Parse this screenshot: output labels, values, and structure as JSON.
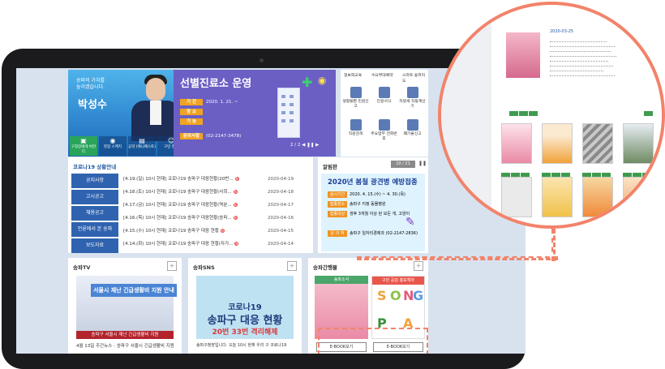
{
  "mayor": {
    "tagline_1": "송파의 가치를",
    "tagline_2": "높이겠습니다.",
    "name": "박성수",
    "tiles": [
      "구청장에게 바란다",
      "현장 스케치",
      "공약 (매니페스토)",
      "구민 청원"
    ]
  },
  "clinic_banner": {
    "title": "선별진료소 운영",
    "rows": [
      {
        "label": "기    간",
        "value": "2020. 1. 21. ~"
      },
      {
        "label": "장    소",
        "value": ""
      },
      {
        "label": "기    능",
        "value": ""
      },
      {
        "label": "문의사항",
        "value": "(02-2147-3478)"
      }
    ],
    "pager": "2 / 2"
  },
  "quick_menu": {
    "headers": [
      "정보화교육",
      "수요부대예약",
      "스마트 송파지도"
    ],
    "items": [
      "생활불편 민원신고",
      "민원서식",
      "지방세 자동계산기",
      "직원검색",
      "주요업무 전화번호",
      "폐기물신고"
    ]
  },
  "covid_board": {
    "title": "코로나19 상황안내",
    "tabs": [
      "공지사항",
      "고시공고",
      "채용공고",
      "언론에서 본 송파",
      "보도자료"
    ],
    "items": [
      {
        "text": "[4.19.(일) 10시 현재] 코로나19 송파구 대응현황(20번...",
        "date": "2020-04-19"
      },
      {
        "text": "[4.18.(토) 10시 현재] 코로나19 송파구 대응현황(사회...",
        "date": "2020-04-18"
      },
      {
        "text": "[4.17.(금) 10시 현재] 코로나19 송파구 대응현황(역분...",
        "date": "2020-04-17"
      },
      {
        "text": "[4.16.(목) 10시 현재] 코로나19 송파구 대응현황(송파...",
        "date": "2020-04-16"
      },
      {
        "text": "[4.15.(수) 10시 현재] 코로나19 송파구 대응 현황",
        "date": "2020-04-15"
      },
      {
        "text": "[4.14.(화) 10시 현재] 코로나19 송파구 대응 현황(자가...",
        "date": "2020-04-14"
      }
    ]
  },
  "notice_board": {
    "title": "알림판",
    "counter": "10 / 21",
    "poster_title": "2020년 봄철 광견병 예방접종",
    "rows": [
      {
        "label": "실시기간",
        "value": "2020. 4. 15.(수) ~ 4. 30.(목)"
      },
      {
        "label": "접종장소",
        "value": "송파구 지정 동물병원"
      },
      {
        "label": "접종대상",
        "value": "생후 3개월 이상 된 모든 개, 고양이"
      },
      {
        "label": "문 의 처",
        "value": "송파구 일자리경제과 (02-2147-2836)"
      }
    ]
  },
  "songpa_tv": {
    "title": "송파TV",
    "thumb_title": "서울시 재난 긴급생활비 지원 안내",
    "thumb_sub": "송파구 서울시 재난 긴급생활비 지원",
    "caption": "4월 13일 주간뉴스 - 송파구 서울시 긴급생활비 지원"
  },
  "songpa_sns": {
    "title": "송파SNS",
    "line_1": "코로나19",
    "line_2": "송파구 대응 현황",
    "line_3": "20번 33번 격리해제",
    "caption": "송파구청장입니다. 오늘 10시 현재 우리 구 코로나19"
  },
  "publications": {
    "title": "송파간행물",
    "ebook_label": "E-BOOK보기",
    "books": [
      "송파소식",
      "구민 공감 홍보책자"
    ],
    "songpa_letters": [
      "S",
      "O",
      "N",
      "G",
      "P",
      "A"
    ]
  },
  "zoom_view": {
    "date": "2020-03-25"
  },
  "colors": {
    "primary": "#2f63b0",
    "clinic": "#6b5fc4",
    "accent": "#f2836a",
    "alert": "#e54848"
  }
}
